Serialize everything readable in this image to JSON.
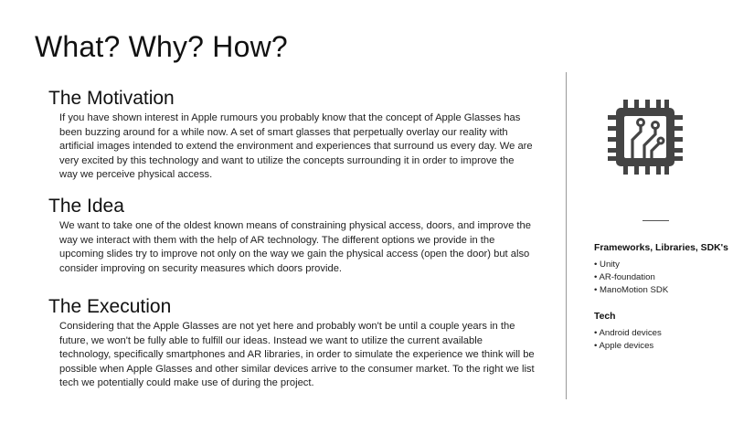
{
  "slide": {
    "title": "What? Why? How?"
  },
  "sections": [
    {
      "heading": "The Motivation",
      "body": "If you have shown interest in Apple rumours you probably know that the concept of Apple Glasses has been buzzing around for a while now. A set of smart glasses that perpetually overlay our reality with artificial images intended to extend the environment and experiences that surround us every day. We are very excited by this technology and want to utilize the concepts surrounding it in order to improve the way we perceive physical access."
    },
    {
      "heading": "The Idea",
      "body": "We want to take one of the oldest known means of constraining physical access, doors, and improve the way we interact with them with the help of AR technology. The different options we provide in the upcoming slides try to improve not only on the way we gain the physical access (open the door) but also consider improving on security measures which doors provide."
    },
    {
      "heading": "The Execution",
      "body": "Considering that the Apple Glasses are not yet here and probably won't be until a couple years in the future, we won't be fully able to fulfill our ideas. Instead we want to utilize the current available technology, specifically smartphones and AR libraries, in order to simulate the experience we think will be possible when Apple Glasses and other similar devices arrive to the consumer market. To the right we list tech we potentially could make use of during the project."
    }
  ],
  "sidebar": {
    "icon": "circuit-chip-icon",
    "icon_color": "#444444",
    "frameworks": {
      "heading": "Frameworks, Libraries, SDK's",
      "items": [
        "Unity",
        "AR-foundation",
        "ManoMotion SDK"
      ]
    },
    "tech": {
      "heading": "Tech",
      "items": [
        "Android devices",
        "Apple devices"
      ]
    }
  }
}
